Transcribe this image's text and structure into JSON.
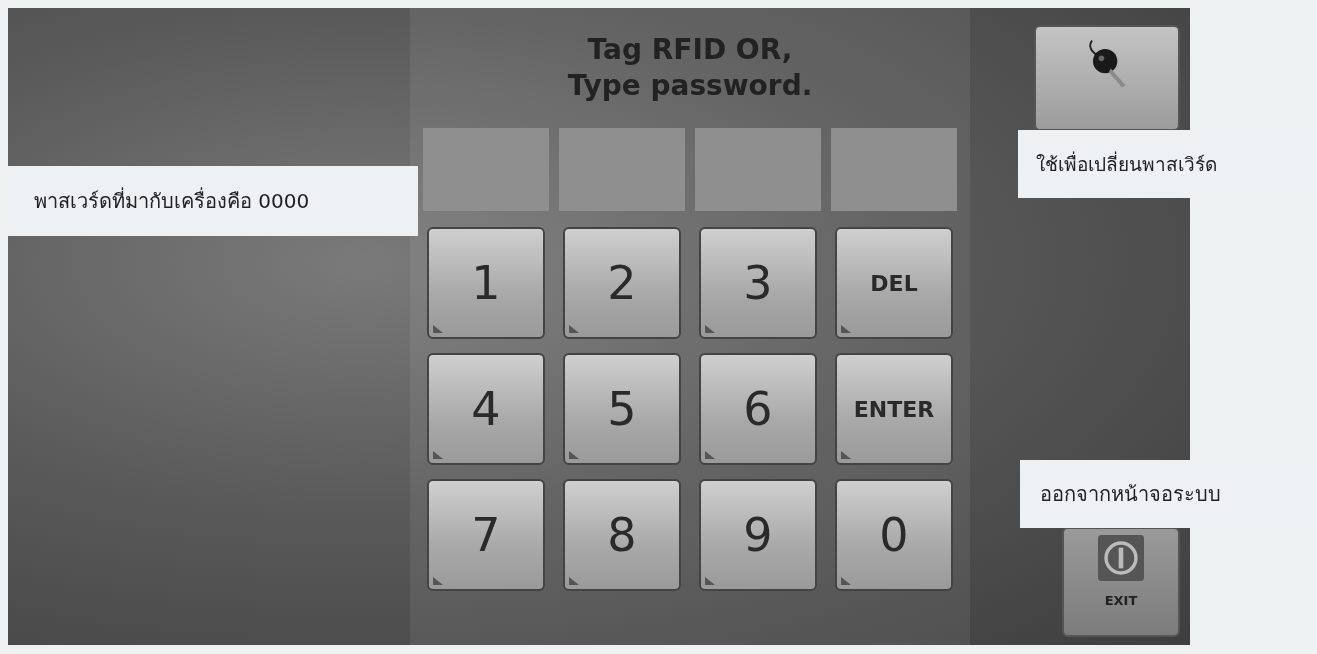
{
  "prompt": [
    "Tag RFID OR,",
    "Type password."
  ],
  "password_slots": [
    {
      "filled": false
    },
    {
      "filled": false
    },
    {
      "filled": false
    },
    {
      "filled": false
    }
  ],
  "keys": [
    {
      "label": "1",
      "kind": "digit"
    },
    {
      "label": "2",
      "kind": "digit"
    },
    {
      "label": "3",
      "kind": "digit"
    },
    {
      "label": "DEL",
      "kind": "command"
    },
    {
      "label": "4",
      "kind": "digit"
    },
    {
      "label": "5",
      "kind": "digit"
    },
    {
      "label": "6",
      "kind": "digit"
    },
    {
      "label": "ENTER",
      "kind": "command"
    },
    {
      "label": "7",
      "kind": "digit"
    },
    {
      "label": "8",
      "kind": "digit"
    },
    {
      "label": "9",
      "kind": "digit"
    },
    {
      "label": "0",
      "kind": "digit"
    }
  ],
  "exit_button": {
    "label": "EXIT"
  },
  "callouts": [
    {
      "text": "พาสเวร์ดที่มากับเครื่องคือ 0000",
      "kind": "left"
    },
    {
      "text": "ใช้เพื่อเปลี่ยนพาสเวิร์ด",
      "kind": "top-right"
    },
    {
      "text": "ออกจากหน้าจอระบบ",
      "kind": "bottom-right"
    }
  ]
}
